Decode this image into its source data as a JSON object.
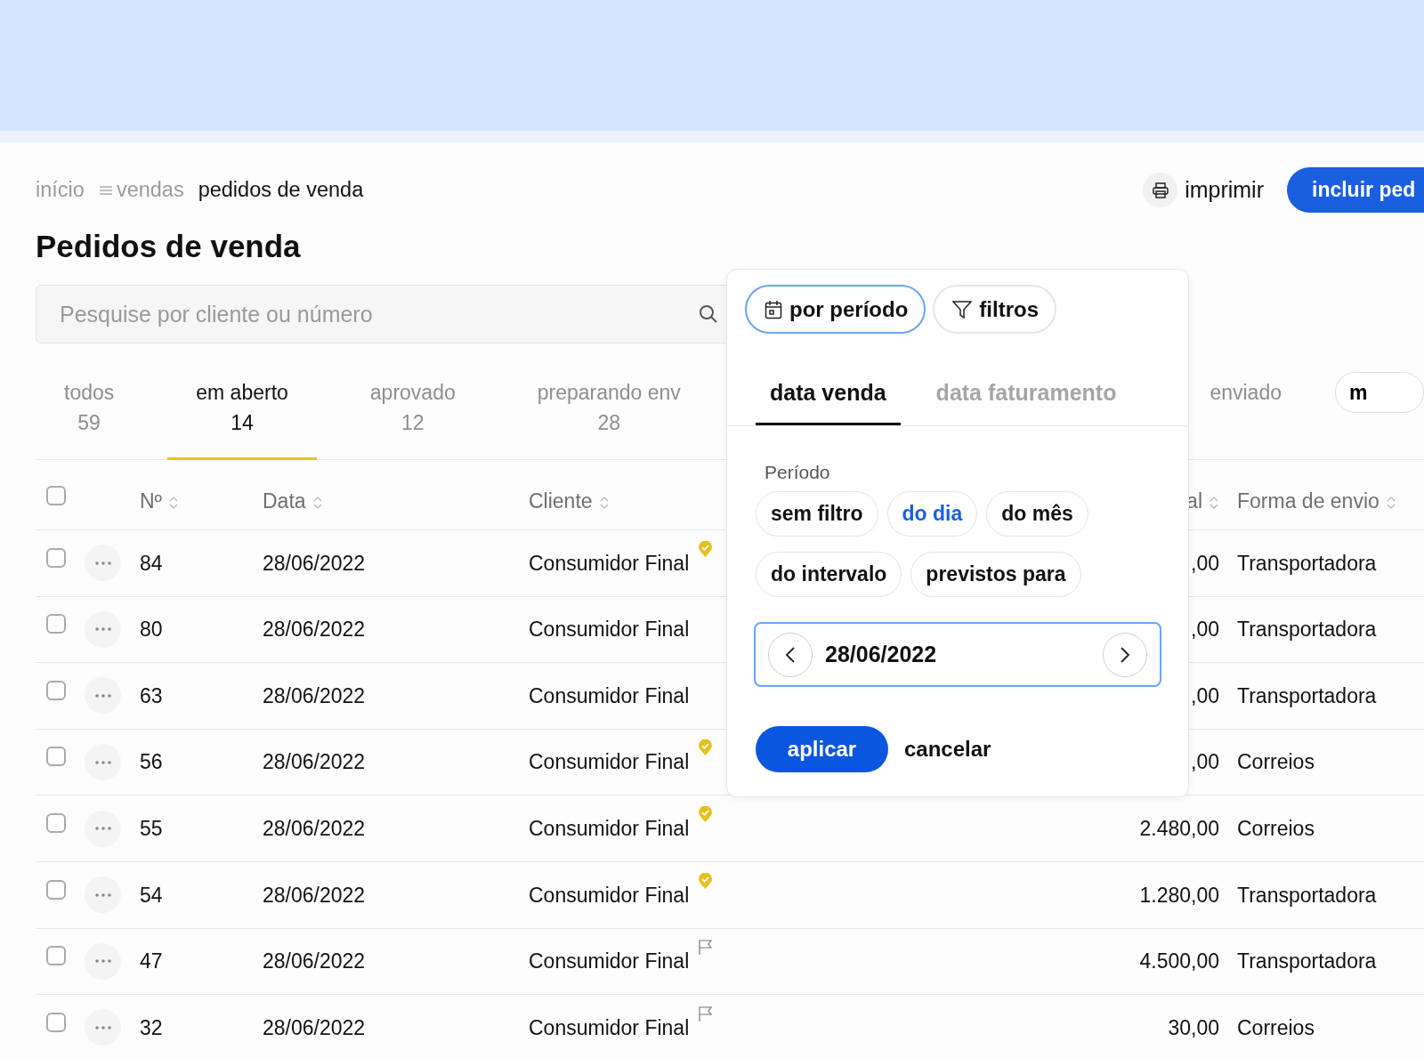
{
  "breadcrumb": [
    {
      "label": "início",
      "kind": "link"
    },
    {
      "label": "vendas",
      "kind": "menu-link"
    },
    {
      "label": "pedidos de venda",
      "kind": "current"
    }
  ],
  "actions": {
    "print": {
      "label": "imprimir"
    },
    "primary": {
      "label": "incluir ped"
    }
  },
  "page_title": "Pedidos de venda",
  "search": {
    "placeholder": "Pesquise por cliente ou número"
  },
  "status_tabs": [
    {
      "label": "todos",
      "count": "59",
      "selected": false
    },
    {
      "label": "em aberto",
      "count": "14",
      "selected": true
    },
    {
      "label": "aprovado",
      "count": "12",
      "selected": false
    },
    {
      "label": "preparando env",
      "count": "28",
      "selected": false
    },
    {
      "label": "enviado",
      "selected": false
    }
  ],
  "more_chip": {
    "label": "m"
  },
  "table": {
    "select_all": {
      "checked": false
    },
    "columns": [
      {
        "label": "Nº",
        "sortable": true
      },
      {
        "label": "Data",
        "sortable": true
      },
      {
        "label": "Cliente",
        "sortable": true
      },
      {
        "label": "al",
        "sortable": true
      },
      {
        "label": "Forma de envio",
        "sortable": true
      }
    ],
    "rows": [
      {
        "checked": false,
        "number": "84",
        "date": "28/06/2022",
        "client": "Consumidor Final",
        "verified": true,
        "flagged": false,
        "total": ",00",
        "shipping": "Transportadora"
      },
      {
        "checked": false,
        "number": "80",
        "date": "28/06/2022",
        "client": "Consumidor Final",
        "verified": false,
        "flagged": false,
        "total": ",00",
        "shipping": "Transportadora"
      },
      {
        "checked": false,
        "number": "63",
        "date": "28/06/2022",
        "client": "Consumidor Final",
        "verified": false,
        "flagged": false,
        "total": ",00",
        "shipping": "Transportadora"
      },
      {
        "checked": false,
        "number": "56",
        "date": "28/06/2022",
        "client": "Consumidor Final",
        "verified": true,
        "flagged": false,
        "total": ",00",
        "shipping": "Correios"
      },
      {
        "checked": false,
        "number": "55",
        "date": "28/06/2022",
        "client": "Consumidor Final",
        "verified": true,
        "flagged": false,
        "total": "2.480,00",
        "shipping": "Correios"
      },
      {
        "checked": false,
        "number": "54",
        "date": "28/06/2022",
        "client": "Consumidor Final",
        "verified": true,
        "flagged": false,
        "total": "1.280,00",
        "shipping": "Transportadora"
      },
      {
        "checked": false,
        "number": "47",
        "date": "28/06/2022",
        "client": "Consumidor Final",
        "verified": false,
        "flagged": true,
        "total": "4.500,00",
        "shipping": "Transportadora"
      },
      {
        "checked": false,
        "number": "32",
        "date": "28/06/2022",
        "client": "Consumidor Final",
        "verified": false,
        "flagged": true,
        "total": "30,00",
        "shipping": "Correios"
      }
    ]
  },
  "popover": {
    "mode_buttons": [
      {
        "label": "por período",
        "kind": "calendar",
        "selected": true
      },
      {
        "label": "filtros",
        "kind": "filter",
        "selected": false
      }
    ],
    "date_tabs": [
      {
        "label": "data venda",
        "selected": true
      },
      {
        "label": "data faturamento",
        "selected": false
      }
    ],
    "period_label": "Período",
    "period_options": [
      {
        "label": "sem filtro",
        "selected": false
      },
      {
        "label": "do dia",
        "selected": true
      },
      {
        "label": "do mês",
        "selected": false
      },
      {
        "label": "do intervalo",
        "selected": false
      },
      {
        "label": "previstos para",
        "selected": false
      }
    ],
    "date_field": {
      "value": "28/06/2022"
    },
    "apply": {
      "label": "aplicar"
    },
    "cancel": {
      "label": "cancelar"
    }
  }
}
